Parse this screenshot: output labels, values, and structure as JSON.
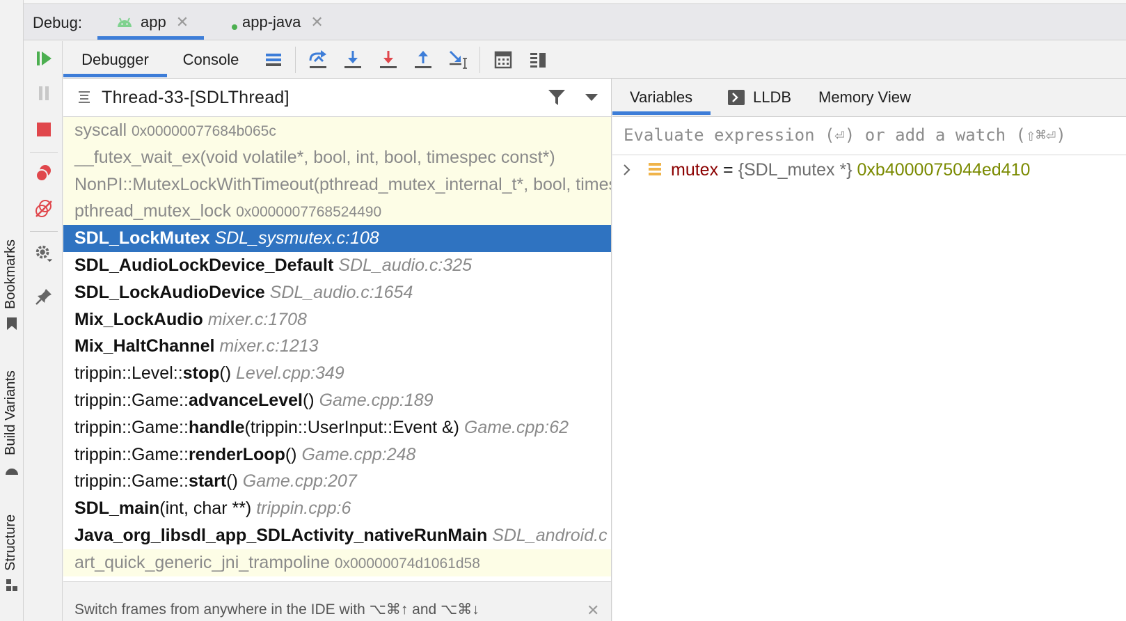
{
  "left_strip": {
    "bookmarks": "Bookmarks",
    "build_variants": "Build Variants",
    "structure": "Structure"
  },
  "debug_header": {
    "label": "Debug:",
    "tabs": [
      {
        "label": "app",
        "icon": "android-icon",
        "selected": true
      },
      {
        "label": "app-java",
        "icon": "running-dot-icon",
        "selected": false
      }
    ],
    "close_glyph": "✕"
  },
  "toolbar": {
    "tabs": [
      {
        "label": "Debugger",
        "selected": true
      },
      {
        "label": "Console",
        "selected": false
      }
    ],
    "buttons": [
      "show-execution-point-icon",
      "step-over-icon",
      "step-into-icon",
      "force-step-into-icon",
      "step-out-icon",
      "run-to-cursor-icon",
      "evaluate-expression-icon",
      "trace-icon"
    ]
  },
  "frames": {
    "thread": "Thread-33-[SDLThread]",
    "rows": [
      {
        "kind": "lib",
        "parts": [
          [
            "n",
            "syscall "
          ],
          [
            "a",
            "0x00000077684b065c"
          ]
        ]
      },
      {
        "kind": "lib",
        "parts": [
          [
            "n",
            "__futex_wait_ex(void volatile*, bool, int, bool, timespec const*)"
          ]
        ]
      },
      {
        "kind": "lib",
        "parts": [
          [
            "n",
            "NonPI::MutexLockWithTimeout(pthread_mutex_internal_t*, bool, timespec const*)"
          ]
        ]
      },
      {
        "kind": "lib",
        "parts": [
          [
            "n",
            "pthread_mutex_lock "
          ],
          [
            "a",
            "0x0000007768524490"
          ]
        ]
      },
      {
        "kind": "selected",
        "parts": [
          [
            "b",
            "SDL_LockMutex "
          ],
          [
            "i",
            "SDL_sysmutex.c:108"
          ]
        ]
      },
      {
        "kind": "user",
        "parts": [
          [
            "b",
            "SDL_AudioLockDevice_Default "
          ],
          [
            "i",
            "SDL_audio.c:325"
          ]
        ]
      },
      {
        "kind": "user",
        "parts": [
          [
            "b",
            "SDL_LockAudioDevice "
          ],
          [
            "i",
            "SDL_audio.c:1654"
          ]
        ]
      },
      {
        "kind": "user",
        "parts": [
          [
            "b",
            "Mix_LockAudio "
          ],
          [
            "i",
            "mixer.c:1708"
          ]
        ]
      },
      {
        "kind": "user",
        "parts": [
          [
            "b",
            "Mix_HaltChannel "
          ],
          [
            "i",
            "mixer.c:1213"
          ]
        ]
      },
      {
        "kind": "user",
        "parts": [
          [
            "n",
            "trippin::Level::"
          ],
          [
            "b",
            "stop"
          ],
          [
            "n",
            "() "
          ],
          [
            "i",
            "Level.cpp:349"
          ]
        ]
      },
      {
        "kind": "user",
        "parts": [
          [
            "n",
            "trippin::Game::"
          ],
          [
            "b",
            "advanceLevel"
          ],
          [
            "n",
            "() "
          ],
          [
            "i",
            "Game.cpp:189"
          ]
        ]
      },
      {
        "kind": "user",
        "parts": [
          [
            "n",
            "trippin::Game::"
          ],
          [
            "b",
            "handle"
          ],
          [
            "n",
            "(trippin::UserInput::Event &) "
          ],
          [
            "i",
            "Game.cpp:62"
          ]
        ]
      },
      {
        "kind": "user",
        "parts": [
          [
            "n",
            "trippin::Game::"
          ],
          [
            "b",
            "renderLoop"
          ],
          [
            "n",
            "() "
          ],
          [
            "i",
            "Game.cpp:248"
          ]
        ]
      },
      {
        "kind": "user",
        "parts": [
          [
            "n",
            "trippin::Game::"
          ],
          [
            "b",
            "start"
          ],
          [
            "n",
            "() "
          ],
          [
            "i",
            "Game.cpp:207"
          ]
        ]
      },
      {
        "kind": "user",
        "parts": [
          [
            "b",
            "SDL_main"
          ],
          [
            "n",
            "(int, char **) "
          ],
          [
            "i",
            "trippin.cpp:6"
          ]
        ]
      },
      {
        "kind": "user",
        "parts": [
          [
            "b",
            "Java_org_libsdl_app_SDLActivity_nativeRunMain "
          ],
          [
            "i",
            "SDL_android.c"
          ]
        ]
      },
      {
        "kind": "lib",
        "parts": [
          [
            "n",
            "art_quick_generic_jni_trampoline "
          ],
          [
            "a",
            "0x00000074d1061d58"
          ]
        ]
      }
    ],
    "hint": "Switch frames from anywhere in the IDE with ⌥⌘↑ and ⌥⌘↓",
    "hint_close": "✕"
  },
  "variables": {
    "tabs": [
      {
        "label": "Variables",
        "selected": true
      },
      {
        "label": "LLDB",
        "selected": false
      },
      {
        "label": "Memory View",
        "selected": false
      }
    ],
    "eval_placeholder": "Evaluate expression (⏎) or add a watch (⇧⌘⏎)",
    "items": [
      {
        "name": "mutex",
        "eq": " = ",
        "type": "{SDL_mutex *} ",
        "value": "0xb4000075044ed410"
      }
    ]
  },
  "colors": {
    "accent": "#3d7dd8",
    "selection": "#2f73c1",
    "library_frame_bg": "#fdfde6",
    "resume_green": "#4caf50",
    "stop_red": "#e0474c"
  }
}
